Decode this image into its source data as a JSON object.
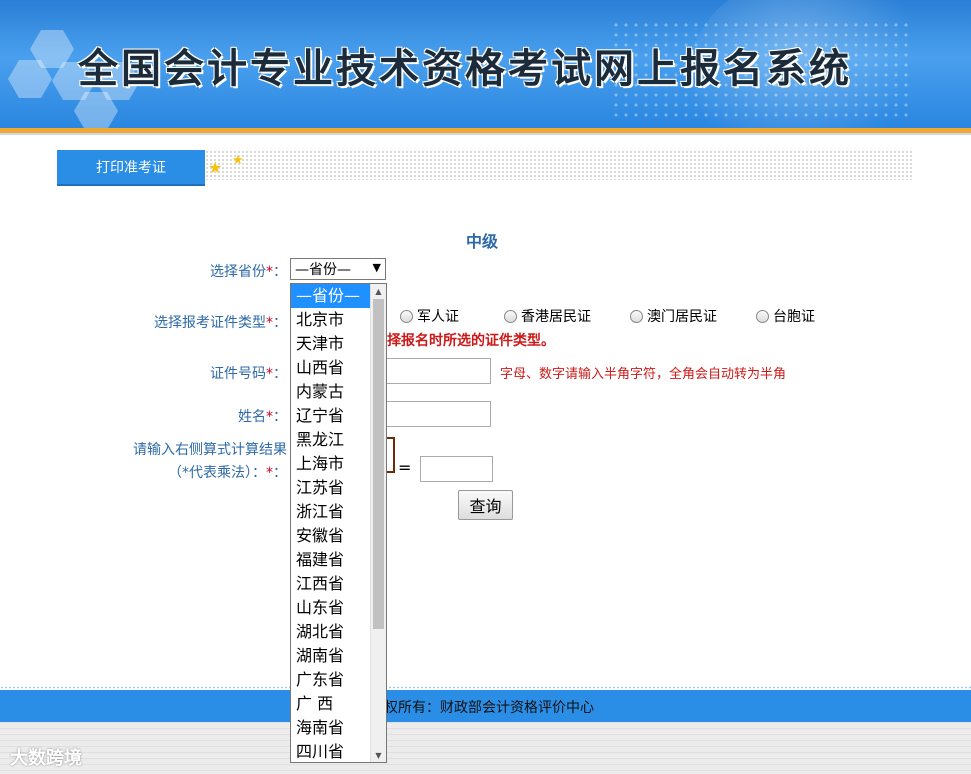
{
  "header": {
    "title": "全国会计专业技术资格考试网上报名系统"
  },
  "tabs": {
    "active_label": "打印准考证"
  },
  "form": {
    "heading": "中级",
    "province_label": "选择省份",
    "id_type_label": "选择报考证件类型",
    "id_number_label": "证件号码",
    "name_label": "姓名",
    "captcha_label_line1": "请输入右侧算式计算结果",
    "captcha_label_line2": "（*代表乘法）：",
    "required_mark": "*",
    "colon": "：",
    "province_selected": "—省份—",
    "id_type_options": [
      "军人证",
      "香港居民证",
      "澳门居民证",
      "台胞证"
    ],
    "id_type_warning": "择报名时所选的证件类型。",
    "id_number_hint": "字母、数字请输入半角字符，全角会自动转为半角",
    "equals": "=",
    "query_button": "查询"
  },
  "province_dropdown": {
    "options": [
      "—省份—",
      "北京市",
      "天津市",
      "山西省",
      "内蒙古",
      "辽宁省",
      "黑龙江",
      "上海市",
      "江苏省",
      "浙江省",
      "安徽省",
      "福建省",
      "江西省",
      "山东省",
      "湖北省",
      "湖南省",
      "广东省",
      "广 西",
      "海南省",
      "四川省"
    ]
  },
  "footer": {
    "copyright_text": "权所有：财政部会计资格评价中心"
  },
  "watermark": {
    "text": "大数跨境"
  },
  "colors": {
    "primary_blue": "#2b8ee6",
    "label_blue": "#2e6aa8",
    "warning_red": "#cc1a1a",
    "accent_orange": "#f0a830"
  }
}
